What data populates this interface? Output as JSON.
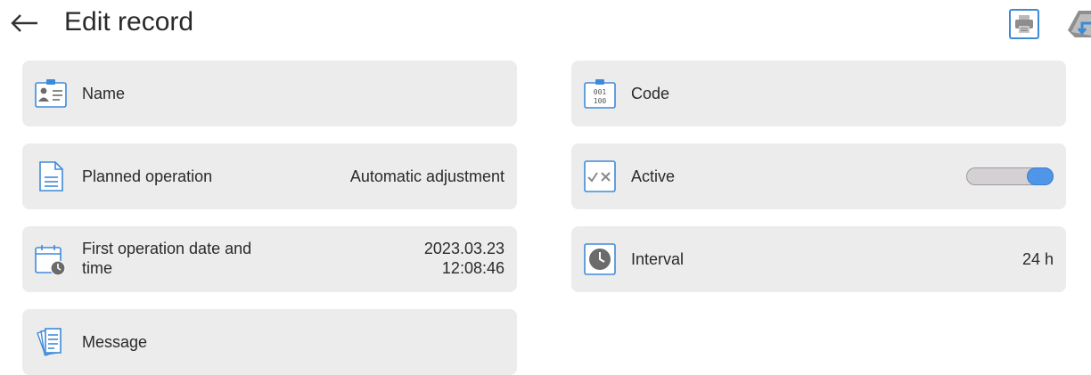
{
  "header": {
    "title": "Edit record",
    "back_icon": "back-arrow-icon",
    "print_icon": "printer-icon",
    "exit_icon": "exit-icon"
  },
  "colors": {
    "card_bg": "#ececec",
    "accent_blue": "#3f8ad8",
    "toggle_on": "#4f95e8"
  },
  "fields": {
    "name": {
      "label": "Name",
      "icon": "id-card-icon"
    },
    "code": {
      "label": "Code",
      "icon": "binary-code-icon"
    },
    "planned_operation": {
      "label": "Planned operation",
      "value": "Automatic adjustment",
      "icon": "document-icon"
    },
    "active": {
      "label": "Active",
      "icon": "check-cross-icon",
      "state": "on"
    },
    "first_operation": {
      "label_line1": "First operation date and",
      "label_line2": "time",
      "date": "2023.03.23",
      "time": "12:08:46",
      "icon": "calendar-clock-icon"
    },
    "interval": {
      "label": "Interval",
      "value": "24 h",
      "icon": "clock-icon"
    },
    "message": {
      "label": "Message",
      "icon": "message-sheets-icon"
    }
  }
}
